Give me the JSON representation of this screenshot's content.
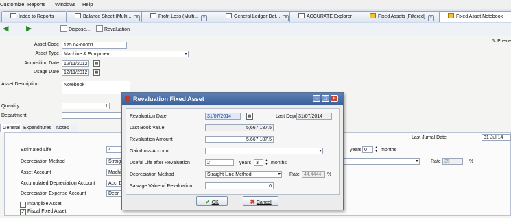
{
  "menu": [
    "Customize",
    "Reports",
    "Windows",
    "Help"
  ],
  "tabs": [
    {
      "label": "Index to Reports",
      "icon": "document-icon"
    },
    {
      "label": "Balance Sheet (Multi...",
      "icon": "report-icon"
    },
    {
      "label": "Profit Loss (Multi...",
      "icon": "report-icon"
    },
    {
      "label": "General Ledger Det...",
      "icon": "report-icon"
    },
    {
      "label": "ACCURATE Explorer",
      "icon": "explorer-icon"
    },
    {
      "label": "Fixed Assets [Filtered]",
      "icon": "fixed-asset-icon"
    },
    {
      "label": "Fixed Asset Notebook",
      "icon": "fixed-asset-icon"
    }
  ],
  "toolbar": {
    "dispose": "Dispose...",
    "revaluation": "Revaluation",
    "preview": "Previe"
  },
  "form": {
    "asset_code_label": "Asset Code",
    "asset_code": "125.04-00001",
    "asset_type_label": "Asset Type",
    "asset_type": "Machine & Equipment",
    "acq_date_label": "Acquisition Date",
    "acq_date": "12/11/2012",
    "usage_date_label": "Usage Date",
    "usage_date": "12/11/2012",
    "asset_desc_label": "Asset Description",
    "asset_desc": "Notebook",
    "quantity_label": "Quantity",
    "quantity": "1",
    "department_label": "Department"
  },
  "main_tabs": [
    "General",
    "Expenditures",
    "Notes"
  ],
  "general": {
    "last_jurnal_label": "Last Jurnal Date",
    "last_jurnal": "31 Jul 14",
    "estimated_life_label": "Estimated Life",
    "estimated_life": "4",
    "years_label": "years",
    "months_value": "0",
    "months_label": "months",
    "dep_method_label": "Depreciation Method",
    "dep_method": "Straig",
    "rate_label": "Rate",
    "rate": "25",
    "percent": "%",
    "asset_account_label": "Asset Account",
    "asset_account": "Machi",
    "accum_dep_label": "Accumulated Depreciation Account",
    "accum_dep": "Acc. D",
    "dep_expense_label": "Depreciation Expense Account",
    "dep_expense": "Depr.",
    "intangible_label": "Intangible Asset",
    "fiscal_label": "Fiscal Fixed Asset"
  },
  "dialog": {
    "title": "Revaluation Fixed Asset",
    "reval_date_label": "Revaluation Date",
    "reval_date": "31/07/2014",
    "last_depr_label": "Last Depr",
    "last_depr": "31/07/2014",
    "last_book_label": "Last Book Value",
    "last_book": "5,667,187.5",
    "reval_amount_label": "Revaluation Amount",
    "reval_amount": "5,667,187.5",
    "gain_loss_label": "Gain/Loss Account",
    "gain_loss": "",
    "useful_life_label": "Useful Life after Revaluation",
    "useful_years": "2",
    "years_label": "years",
    "useful_months": "3",
    "months_label": "months",
    "dep_method_label": "Depreciation Method",
    "dep_method": "Straight Line Method",
    "rate_label": "Rate",
    "rate": "44.4444",
    "percent": "%",
    "salvage_label": "Salvage Value of Revaluation",
    "salvage": "0",
    "ok_label": "OK",
    "cancel_label": "Cancel"
  },
  "colors": {
    "title_bar": "#3b5f98",
    "accent_green": "#2b8a2b",
    "cancel_red": "#c9402d"
  }
}
